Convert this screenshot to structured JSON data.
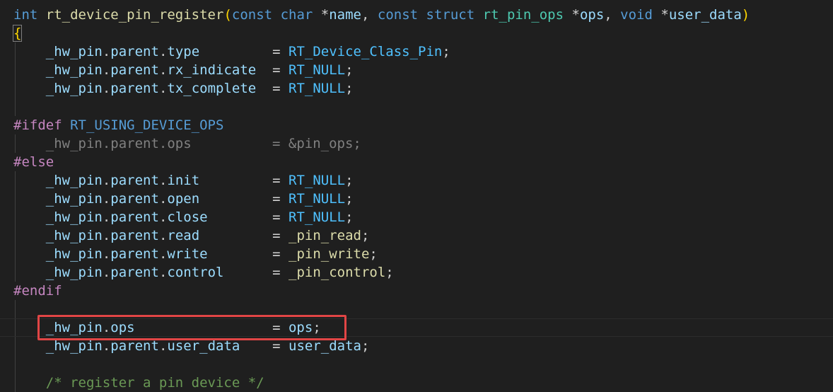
{
  "editor": {
    "signature": {
      "ret_type": "int",
      "func_name": "rt_device_pin_register",
      "open_paren": "(",
      "kw_const1": "const",
      "kw_char": "char",
      "star1": "*",
      "p_name": "name",
      "comma1": ", ",
      "kw_const2": "const",
      "kw_struct": "struct",
      "ops_type": "rt_pin_ops",
      "star2": "*",
      "p_ops": "ops",
      "comma2": ", ",
      "kw_void": "void",
      "star3": "*",
      "p_user": "user_data",
      "close_paren": ")"
    },
    "open_brace": "{",
    "common_assignments": [
      {
        "obj": "_hw_pin",
        "dot": ".",
        "mid": "parent",
        "dot2": ".",
        "field": "type",
        "pad": "         ",
        "eq": "= ",
        "value": "RT_Device_Class_Pin",
        "semi": ";"
      },
      {
        "obj": "_hw_pin",
        "dot": ".",
        "mid": "parent",
        "dot2": ".",
        "field": "rx_indicate",
        "pad": "  ",
        "eq": "= ",
        "value": "RT_NULL",
        "semi": ";"
      },
      {
        "obj": "_hw_pin",
        "dot": ".",
        "mid": "parent",
        "dot2": ".",
        "field": "tx_complete",
        "pad": "  ",
        "eq": "= ",
        "value": "RT_NULL",
        "semi": ";"
      }
    ],
    "ifdef": {
      "directive": "#ifdef",
      "macro": "RT_USING_DEVICE_OPS"
    },
    "inactive_line": "    _hw_pin.parent.ops          = &pin_ops;",
    "else_directive": "#else",
    "else_assignments": [
      {
        "obj": "_hw_pin",
        "dot": ".",
        "mid": "parent",
        "dot2": ".",
        "field": "init",
        "pad": "         ",
        "eq": "= ",
        "value": "RT_NULL",
        "semi": ";",
        "kind": "macro"
      },
      {
        "obj": "_hw_pin",
        "dot": ".",
        "mid": "parent",
        "dot2": ".",
        "field": "open",
        "pad": "         ",
        "eq": "= ",
        "value": "RT_NULL",
        "semi": ";",
        "kind": "macro"
      },
      {
        "obj": "_hw_pin",
        "dot": ".",
        "mid": "parent",
        "dot2": ".",
        "field": "close",
        "pad": "        ",
        "eq": "= ",
        "value": "RT_NULL",
        "semi": ";",
        "kind": "macro"
      },
      {
        "obj": "_hw_pin",
        "dot": ".",
        "mid": "parent",
        "dot2": ".",
        "field": "read",
        "pad": "         ",
        "eq": "= ",
        "value": "_pin_read",
        "semi": ";",
        "kind": "func"
      },
      {
        "obj": "_hw_pin",
        "dot": ".",
        "mid": "parent",
        "dot2": ".",
        "field": "write",
        "pad": "        ",
        "eq": "= ",
        "value": "_pin_write",
        "semi": ";",
        "kind": "func"
      },
      {
        "obj": "_hw_pin",
        "dot": ".",
        "mid": "parent",
        "dot2": ".",
        "field": "control",
        "pad": "      ",
        "eq": "= ",
        "value": "_pin_control",
        "semi": ";",
        "kind": "func"
      }
    ],
    "endif_directive": "#endif",
    "ops_assignment": {
      "obj": "_hw_pin",
      "dot": ".",
      "field": "ops",
      "pad": "                 ",
      "eq": "= ",
      "value": "ops",
      "semi": ";"
    },
    "user_data_assignment": {
      "obj": "_hw_pin",
      "dot": ".",
      "mid": "parent",
      "dot2": ".",
      "field": "user_data",
      "pad": "    ",
      "eq": "= ",
      "value": "user_data",
      "semi": ";"
    },
    "comment_line": "    /* register a pin device */",
    "highlight_color": "#e14545"
  }
}
